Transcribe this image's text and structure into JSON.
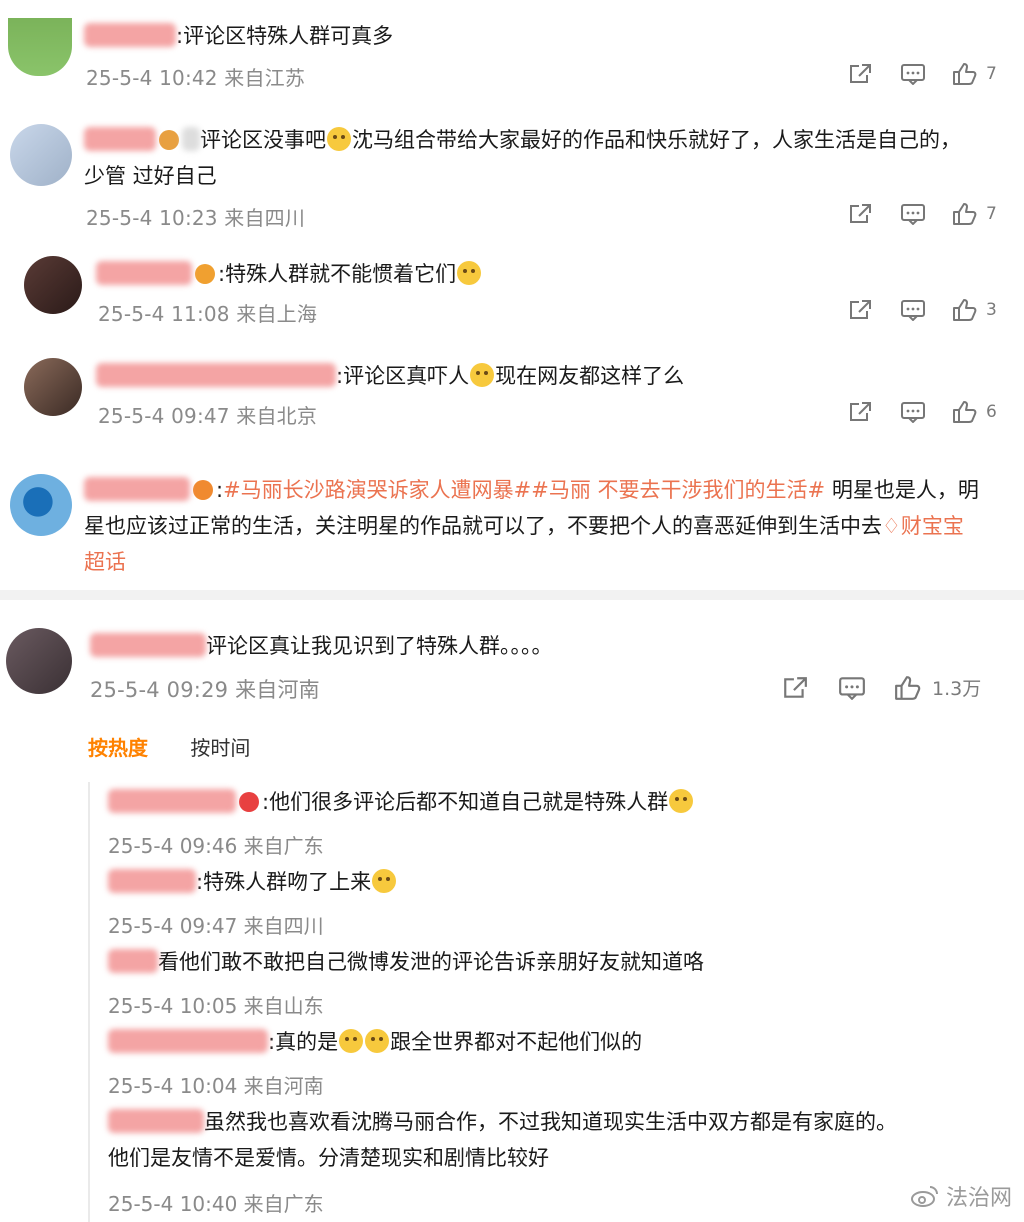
{
  "comments": [
    {
      "text": ":评论区特殊人群可真多",
      "meta": "25-5-4 10:42 来自江苏",
      "likes": "7"
    },
    {
      "text_a": "评论区没事吧",
      "text_b": "沈马组合带给大家最好的作品和快乐就好了，人家生活是自己的，",
      "text_c": "少管 过好自己",
      "meta": "25-5-4 10:23 来自四川",
      "likes": "7"
    },
    {
      "text": ":特殊人群就不能惯着它们",
      "meta": "25-5-4 11:08 来自上海",
      "likes": "3"
    },
    {
      "text_a": ":评论区真吓人",
      "text_b": "现在网友都这样了么",
      "meta": "25-5-4 09:47 来自北京",
      "likes": "6"
    },
    {
      "colon": ":",
      "hashtags": "#马丽长沙路演哭诉家人遭网暴##马丽 不要去干涉我们的生活#",
      "text_a": " 明星也是人，明",
      "text_b": "星也应该过正常的生活，关注明星的作品就可以了，不要把个人的喜恶延伸到生活中去",
      "super_topic_a": "财宝宝",
      "super_topic_b": "超话"
    },
    {
      "text": "评论区真让我见识到了特殊人群。。。。",
      "meta": "25-5-4 09:29 来自河南",
      "likes": "1.3万"
    }
  ],
  "sort_tabs": {
    "hot": "按热度",
    "time": "按时间"
  },
  "replies": [
    {
      "text": ":他们很多评论后都不知道自己就是特殊人群",
      "meta": "25-5-4 09:46 来自广东"
    },
    {
      "text": ":特殊人群吻了上来",
      "meta": "25-5-4 09:47 来自四川"
    },
    {
      "text": "看他们敢不敢把自己微博发泄的评论告诉亲朋好友就知道咯",
      "meta": "25-5-4 10:05 来自山东"
    },
    {
      "text_a": ":真的是",
      "text_b": "跟全世界都对不起他们似的",
      "meta": "25-5-4 10:04 来自河南"
    },
    {
      "text_a": "虽然我也喜欢看沈腾马丽合作，不过我知道现实生活中双方都是有家庭的。",
      "text_b": "他们是友情不是爱情。分清楚现实和剧情比较好",
      "meta": "25-5-4 10:40 来自广东"
    }
  ],
  "watermark": "法治网",
  "colors": {
    "accent": "#ff8200",
    "hashtag": "#eb7350",
    "meta": "#8a8a8a",
    "name_blur": "#f0a0a0"
  },
  "icons": [
    "share-icon",
    "comment-icon",
    "like-icon",
    "weibo-logo-icon"
  ]
}
